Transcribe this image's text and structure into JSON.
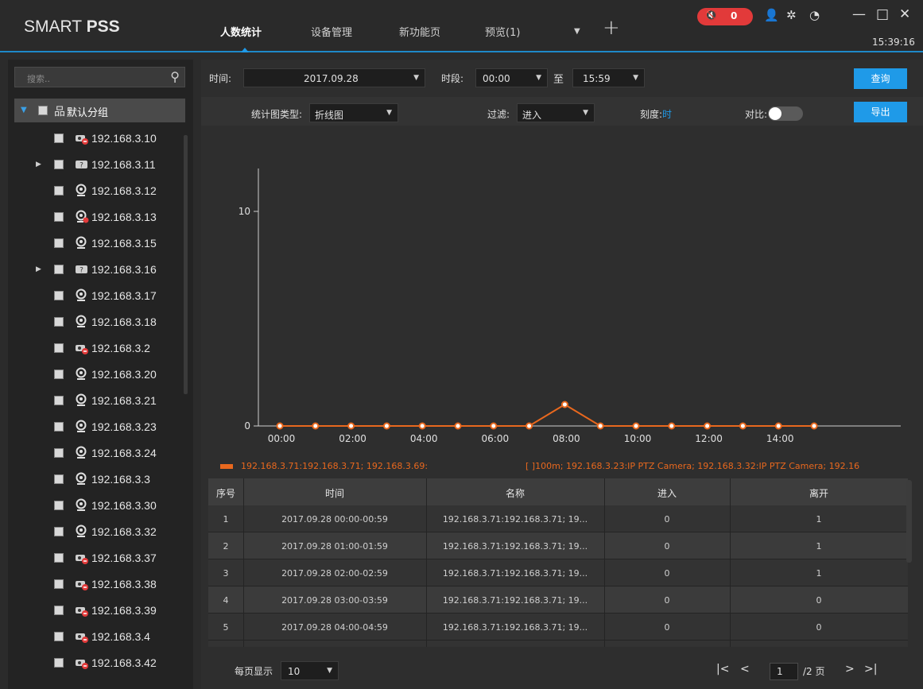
{
  "app": {
    "brand_light": "SMART ",
    "brand_bold": "PSS",
    "tabs": [
      {
        "label": "人数统计",
        "active": true
      },
      {
        "label": "设备管理",
        "active": false
      },
      {
        "label": "新功能页",
        "active": false
      },
      {
        "label": "预览(1)",
        "active": false
      }
    ],
    "alarm_count": "0",
    "clock": "15:39:16",
    "accent_color": "#1f9ae8",
    "alarm_color": "#e23a3a"
  },
  "sidebar": {
    "search_placeholder": "搜索..",
    "group_label": "默认分组",
    "devices": [
      {
        "ip": "192.168.3.10",
        "icon": "camera-offline-icon",
        "expandable": false
      },
      {
        "ip": "192.168.3.11",
        "icon": "nvr-warning-icon",
        "expandable": true
      },
      {
        "ip": "192.168.3.12",
        "icon": "webcam-icon",
        "expandable": false
      },
      {
        "ip": "192.168.3.13",
        "icon": "webcam-offline-icon",
        "expandable": false
      },
      {
        "ip": "192.168.3.15",
        "icon": "webcam-icon",
        "expandable": false
      },
      {
        "ip": "192.168.3.16",
        "icon": "nvr-warning-icon",
        "expandable": true
      },
      {
        "ip": "192.168.3.17",
        "icon": "webcam-icon",
        "expandable": false
      },
      {
        "ip": "192.168.3.18",
        "icon": "webcam-icon",
        "expandable": false
      },
      {
        "ip": "192.168.3.2",
        "icon": "camera-offline-icon",
        "expandable": false
      },
      {
        "ip": "192.168.3.20",
        "icon": "webcam-icon",
        "expandable": false
      },
      {
        "ip": "192.168.3.21",
        "icon": "webcam-icon",
        "expandable": false
      },
      {
        "ip": "192.168.3.23",
        "icon": "webcam-icon",
        "expandable": false
      },
      {
        "ip": "192.168.3.24",
        "icon": "webcam-icon",
        "expandable": false
      },
      {
        "ip": "192.168.3.3",
        "icon": "webcam-icon",
        "expandable": false
      },
      {
        "ip": "192.168.3.30",
        "icon": "webcam-icon",
        "expandable": false
      },
      {
        "ip": "192.168.3.32",
        "icon": "webcam-icon",
        "expandable": false
      },
      {
        "ip": "192.168.3.37",
        "icon": "camera-offline-icon",
        "expandable": false
      },
      {
        "ip": "192.168.3.38",
        "icon": "camera-offline-icon",
        "expandable": false
      },
      {
        "ip": "192.168.3.39",
        "icon": "camera-offline-icon",
        "expandable": false
      },
      {
        "ip": "192.168.3.4",
        "icon": "camera-offline-icon",
        "expandable": false
      },
      {
        "ip": "192.168.3.42",
        "icon": "camera-offline-icon",
        "expandable": false
      }
    ]
  },
  "query": {
    "time_label": "时间:",
    "date_value": "2017.09.28",
    "period_label": "时段:",
    "start_time": "00:00",
    "to_label": "至",
    "end_time": "15:59",
    "query_button": "查询"
  },
  "options": {
    "chart_type_label": "统计图类型:",
    "chart_type_value": "折线图",
    "filter_label": "过滤:",
    "filter_value": "进入",
    "scale_label": "刻度:",
    "scale_value": "时",
    "compare_label": "对比:",
    "compare_on": false,
    "export_button": "导出"
  },
  "chart_data": {
    "type": "line",
    "x": [
      "00:00",
      "01:00",
      "02:00",
      "03:00",
      "04:00",
      "05:00",
      "06:00",
      "07:00",
      "08:00",
      "09:00",
      "10:00",
      "11:00",
      "12:00",
      "13:00",
      "14:00",
      "15:00"
    ],
    "x_tick_labels": [
      "00:00",
      "02:00",
      "04:00",
      "06:00",
      "08:00",
      "10:00",
      "12:00",
      "14:00"
    ],
    "y_tick_labels": [
      "0",
      "10"
    ],
    "ylim": [
      0,
      12
    ],
    "series": [
      {
        "values": [
          0,
          0,
          0,
          0,
          0,
          0,
          0,
          0,
          1,
          0,
          0,
          0,
          0,
          0,
          0,
          0
        ],
        "color": "#e8681e"
      }
    ],
    "legend_left": "192.168.3.71:192.168.3.71; 192.168.3.69:",
    "legend_right": "[ ]100m; 192.168.3.23:IP PTZ Camera; 192.168.3.32:IP PTZ Camera; 192.16"
  },
  "table": {
    "headers": [
      "序号",
      "时间",
      "名称",
      "进入",
      "离开"
    ],
    "rows": [
      [
        "1",
        "2017.09.28  00:00-00:59",
        "192.168.3.71:192.168.3.71; 19...",
        "0",
        "1"
      ],
      [
        "2",
        "2017.09.28  01:00-01:59",
        "192.168.3.71:192.168.3.71; 19...",
        "0",
        "1"
      ],
      [
        "3",
        "2017.09.28  02:00-02:59",
        "192.168.3.71:192.168.3.71; 19...",
        "0",
        "1"
      ],
      [
        "4",
        "2017.09.28  03:00-03:59",
        "192.168.3.71:192.168.3.71; 19...",
        "0",
        "0"
      ],
      [
        "5",
        "2017.09.28  04:00-04:59",
        "192.168.3.71:192.168.3.71; 19...",
        "0",
        "0"
      ]
    ]
  },
  "pager": {
    "per_page_label": "每页显示",
    "per_page_value": "10",
    "current_page": "1",
    "total_pages_label": "/2 页"
  }
}
